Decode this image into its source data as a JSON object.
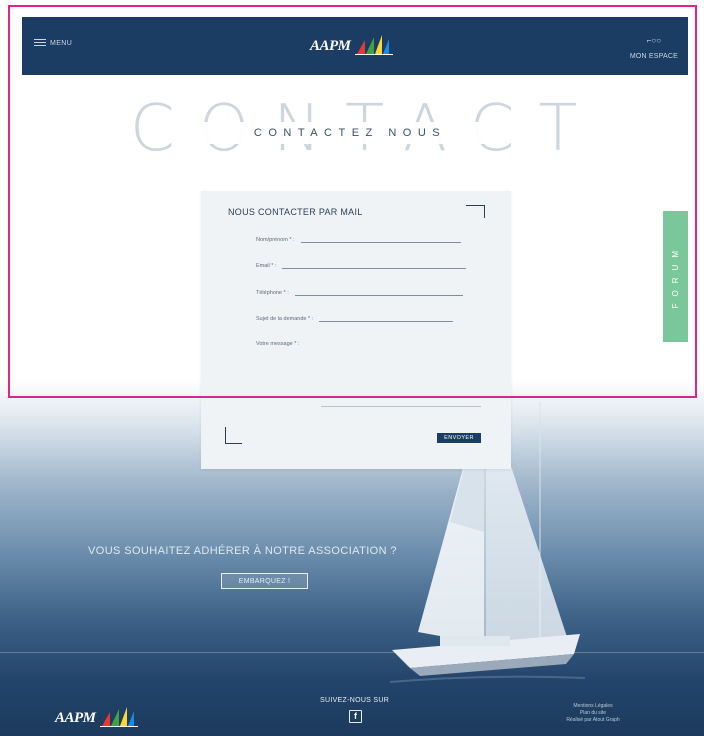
{
  "header": {
    "menu_label": "MENU",
    "logo_text": "AAPM",
    "my_space_label": "MON ESPACE"
  },
  "title": {
    "big": "CONTACT",
    "sub": "CONTACTEZ NOUS"
  },
  "form": {
    "title": "NOUS CONTACTER PAR MAIL",
    "fields": [
      {
        "label": "Nom/prénom * :",
        "value": ""
      },
      {
        "label": "Email * :",
        "value": ""
      },
      {
        "label": "Téléphone * :",
        "value": ""
      },
      {
        "label": "Sujet de la demande * :",
        "value": ""
      },
      {
        "label": "Votre message * :",
        "value": ""
      }
    ],
    "submit_label": "ENVOYER"
  },
  "forum_tab": "FORUM",
  "cta": {
    "text": "VOUS SOUHAITEZ ADHÉRER À NOTRE ASSOCIATION ?",
    "button": "EMBARQUEZ !"
  },
  "footer": {
    "logo_text": "AAPM",
    "follow_label": "SUIVEZ-NOUS SUR",
    "facebook_icon": "f",
    "links": [
      "Mentions Légales",
      "Plan du site",
      "Réalisé par Atout Graph"
    ]
  },
  "colors": {
    "header_bg": "#1c3d63",
    "forum_tab": "#79c79a",
    "highlight_border": "#e0248c",
    "card_bg": "#eff3f6"
  }
}
